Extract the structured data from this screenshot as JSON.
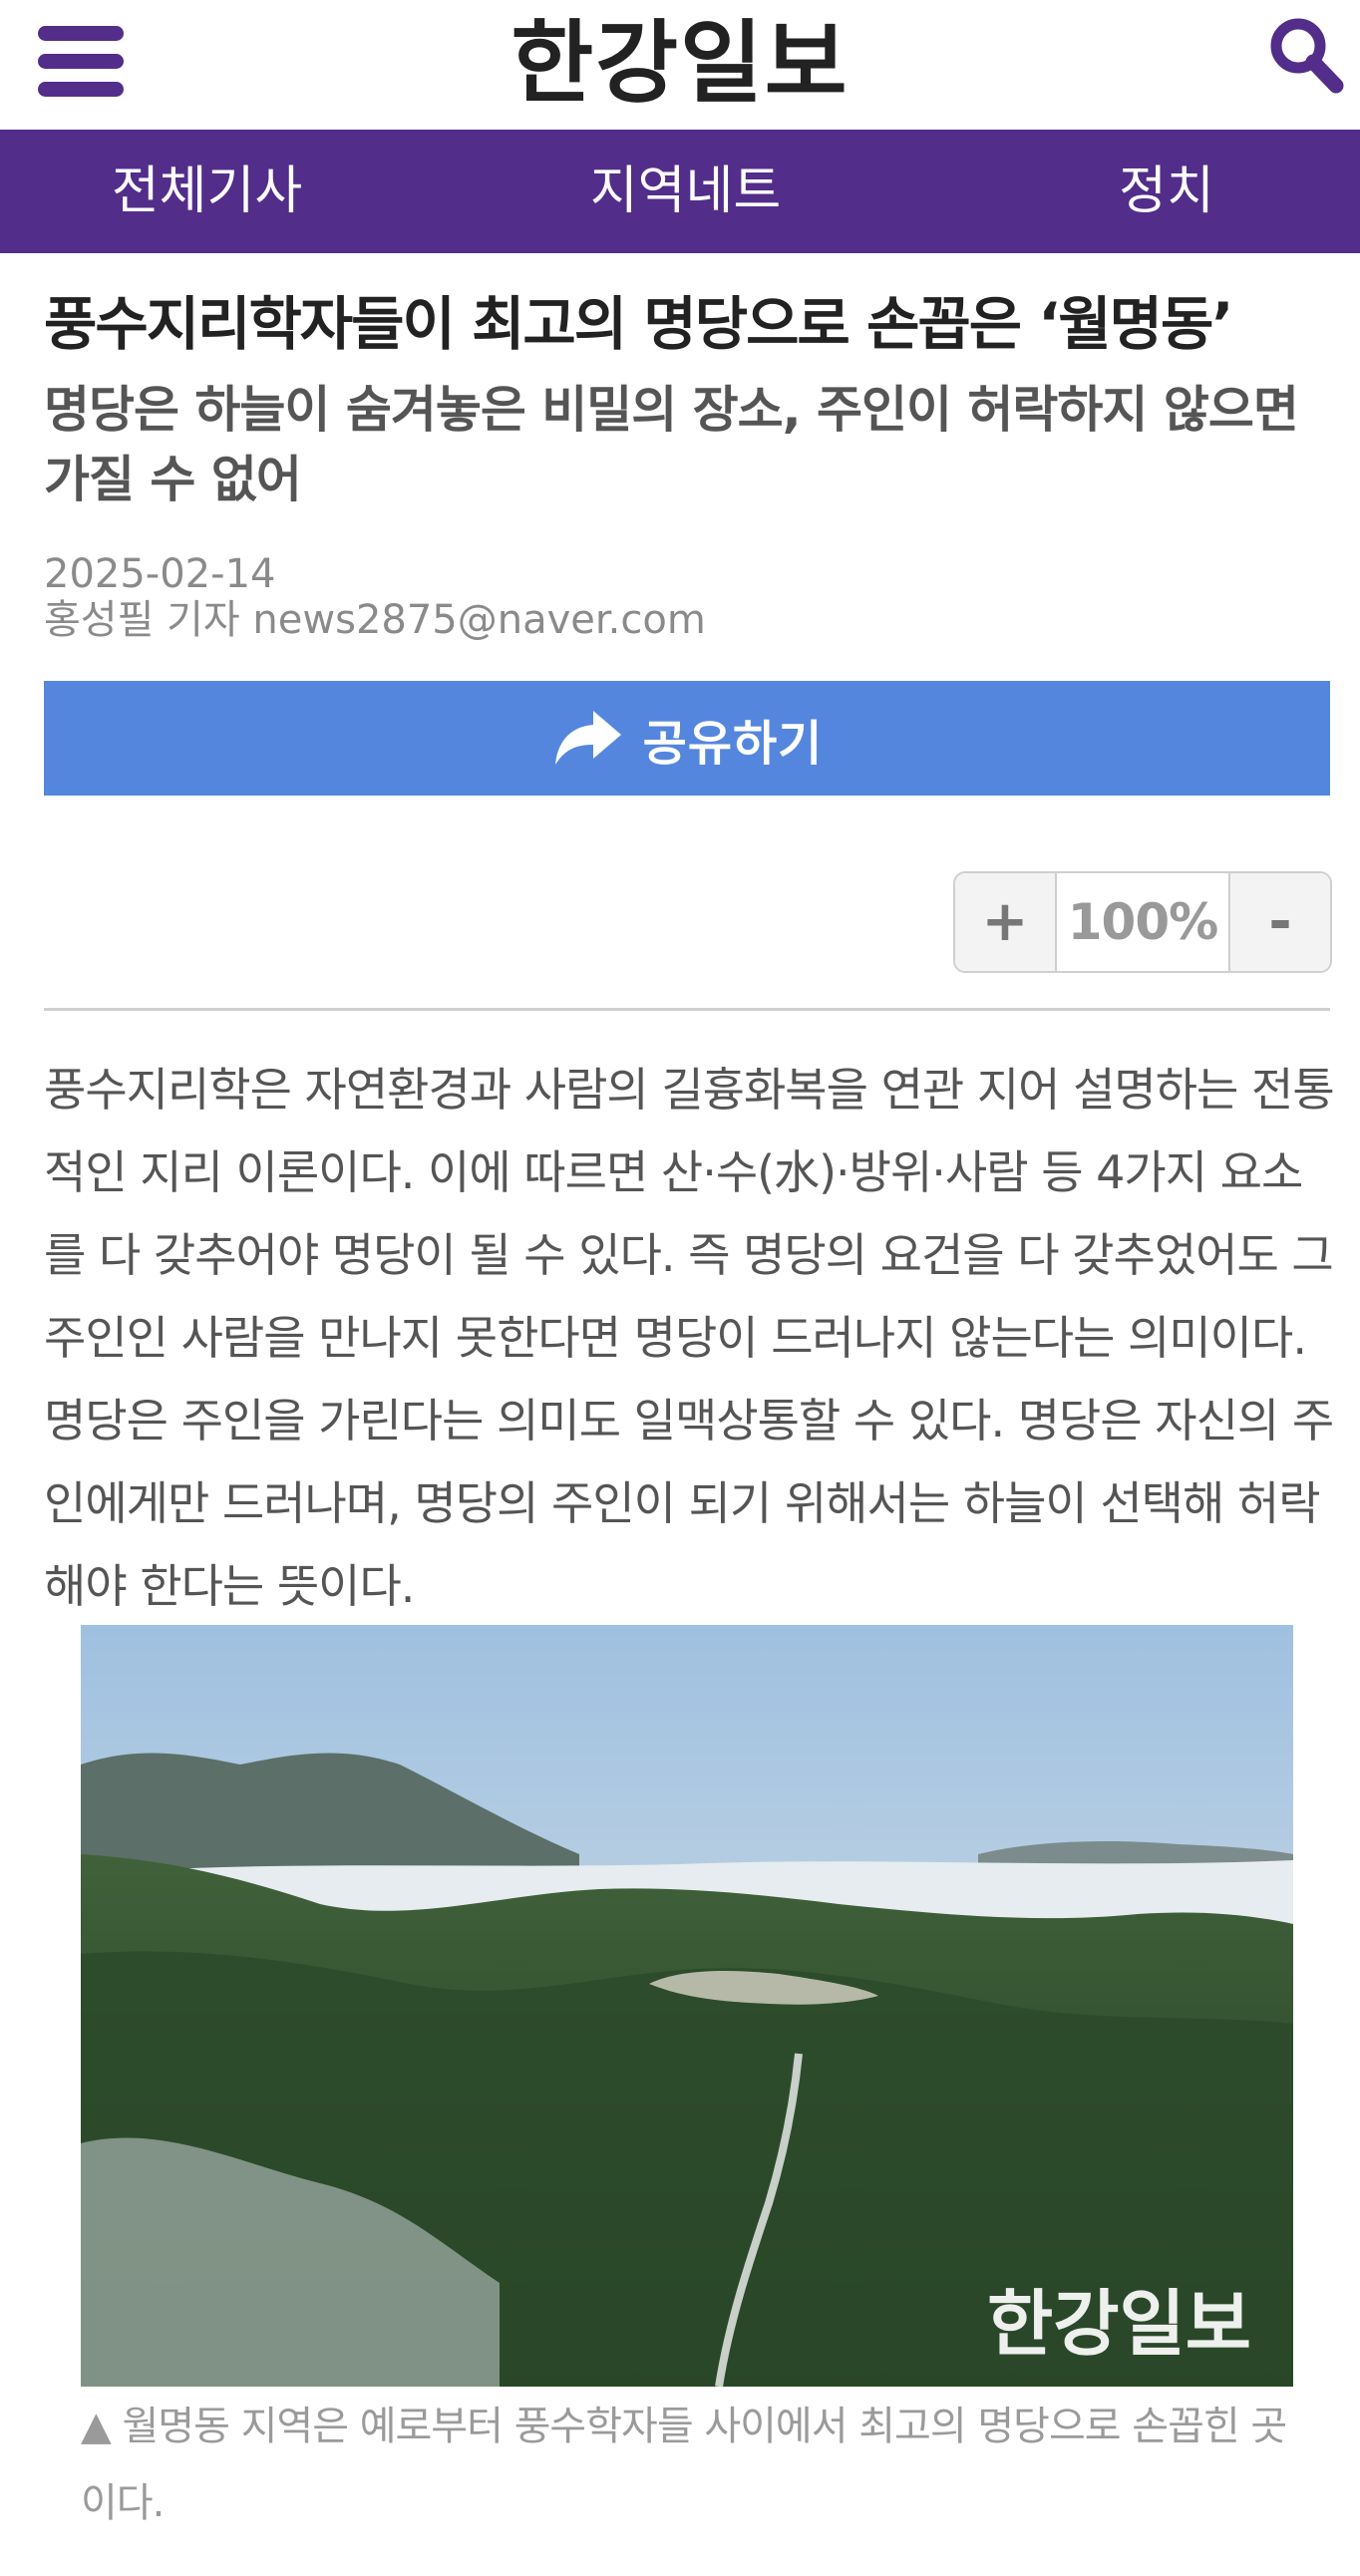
{
  "header": {
    "menu_icon": "hamburger-menu-icon",
    "logo_text": "한강일보",
    "search_icon": "search-icon",
    "brand_color": "#532d8a"
  },
  "nav": {
    "items": [
      {
        "label": "전체기사"
      },
      {
        "label": "지역네트"
      },
      {
        "label": "정치"
      }
    ]
  },
  "article": {
    "title": "풍수지리학자들이 최고의 명당으로 손꼽은 ‘월명동’",
    "subtitle": "명당은 하늘이 숨겨놓은 비밀의 장소, 주인이 허락하지 않으면 가질 수 없어",
    "date": "2025-02-14",
    "author": "홍성필 기자 news2875@naver.com",
    "share": {
      "label": "공유하기",
      "icon": "share-arrow-icon",
      "color": "#5486de"
    },
    "zoom": {
      "plus": "+",
      "value": "100%",
      "minus": "-"
    },
    "body": "풍수지리학은 자연환경과 사람의 길흉화복을 연관 지어 설명하는 전통적인 지리 이론이다. 이에 따르면 산·수(水)·방위·사람 등 4가지 요소를 다 갖추어야 명당이 될 수 있다. 즉 명당의 요건을 다 갖추었어도 그 주인인 사람을 만나지 못한다면 명당이 드러나지 않는다는 의미이다. 명당은 주인을 가린다는 의미도 일맥상통할 수 있다. 명당은 자신의 주인에게만 드러나며, 명당의 주인이 되기 위해서는 하늘이 선택해 허락해야 한다는 뜻이다.",
    "photo": {
      "watermark": "한강일보",
      "caption": "▲ 월명동 지역은 예로부터 풍수학자들 사이에서 최고의 명당으로 손꼽힌 곳이다."
    }
  }
}
